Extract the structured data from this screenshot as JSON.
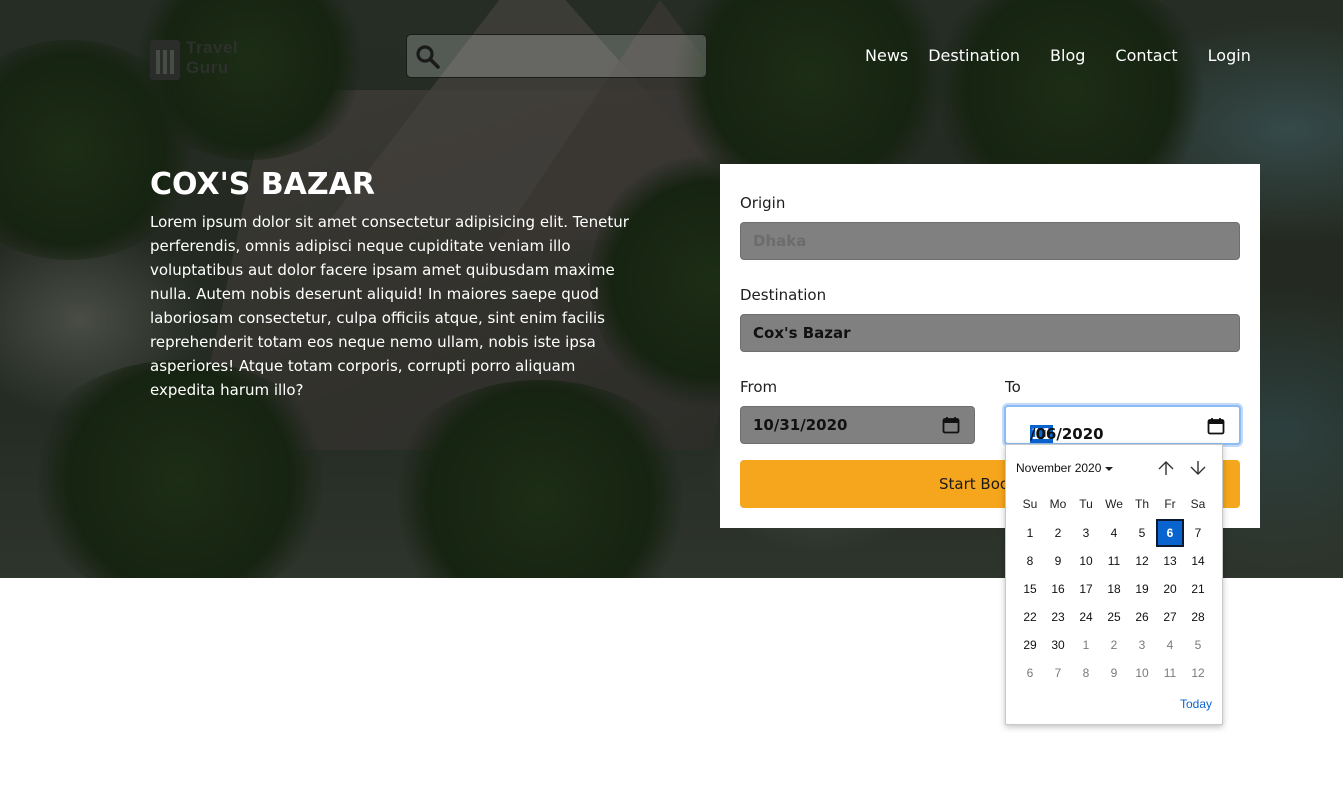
{
  "header": {
    "logo_line1": "Travel",
    "logo_line2": "Guru",
    "search": {
      "value": "",
      "placeholder": ""
    },
    "nav": [
      "News",
      "Destination",
      "Blog",
      "Contact",
      "Login"
    ]
  },
  "hero": {
    "title": "COX'S BAZAR",
    "body": "Lorem ipsum dolor sit amet consectetur adipisicing elit. Tenetur perferendis, omnis adipisci neque cupiditate veniam illo voluptatibus aut dolor facere ipsam amet quibusdam maxime nulla. Autem nobis deserunt aliquid! In maiores saepe quod laboriosam consectetur, culpa officiis atque, sint enim facilis reprehenderit totam eos neque nemo ullam, nobis iste ipsa asperiores! Atque totam corporis, corrupti porro aliquam expedita harum illo?"
  },
  "booking": {
    "origin_label": "Origin",
    "origin_value": "Dhaka",
    "destination_label": "Destination",
    "destination_value": "Cox's Bazar",
    "from_label": "From",
    "from_value": "10/31/2020",
    "to_label": "To",
    "to_month_selected": "11",
    "to_rest": "/06/2020",
    "button_label": "Start Booking"
  },
  "picker": {
    "month_label": "November 2020",
    "weekdays": [
      "Su",
      "Mo",
      "Tu",
      "We",
      "Th",
      "Fr",
      "Sa"
    ],
    "days": [
      {
        "d": "1"
      },
      {
        "d": "2"
      },
      {
        "d": "3"
      },
      {
        "d": "4"
      },
      {
        "d": "5"
      },
      {
        "d": "6",
        "sel": true
      },
      {
        "d": "7"
      },
      {
        "d": "8"
      },
      {
        "d": "9"
      },
      {
        "d": "10"
      },
      {
        "d": "11"
      },
      {
        "d": "12"
      },
      {
        "d": "13"
      },
      {
        "d": "14"
      },
      {
        "d": "15"
      },
      {
        "d": "16"
      },
      {
        "d": "17"
      },
      {
        "d": "18"
      },
      {
        "d": "19"
      },
      {
        "d": "20"
      },
      {
        "d": "21"
      },
      {
        "d": "22"
      },
      {
        "d": "23"
      },
      {
        "d": "24"
      },
      {
        "d": "25"
      },
      {
        "d": "26"
      },
      {
        "d": "27"
      },
      {
        "d": "28"
      },
      {
        "d": "29"
      },
      {
        "d": "30"
      },
      {
        "d": "1",
        "other": true
      },
      {
        "d": "2",
        "other": true
      },
      {
        "d": "3",
        "other": true
      },
      {
        "d": "4",
        "other": true
      },
      {
        "d": "5",
        "other": true
      },
      {
        "d": "6",
        "other": true
      },
      {
        "d": "7",
        "other": true
      },
      {
        "d": "8",
        "other": true
      },
      {
        "d": "9",
        "other": true
      },
      {
        "d": "10",
        "other": true
      },
      {
        "d": "11",
        "other": true
      },
      {
        "d": "12",
        "other": true
      }
    ],
    "today_label": "Today"
  },
  "colors": {
    "accent_button": "#f6a61c",
    "field_gray": "#808080",
    "selection_blue": "#0a64d0"
  }
}
